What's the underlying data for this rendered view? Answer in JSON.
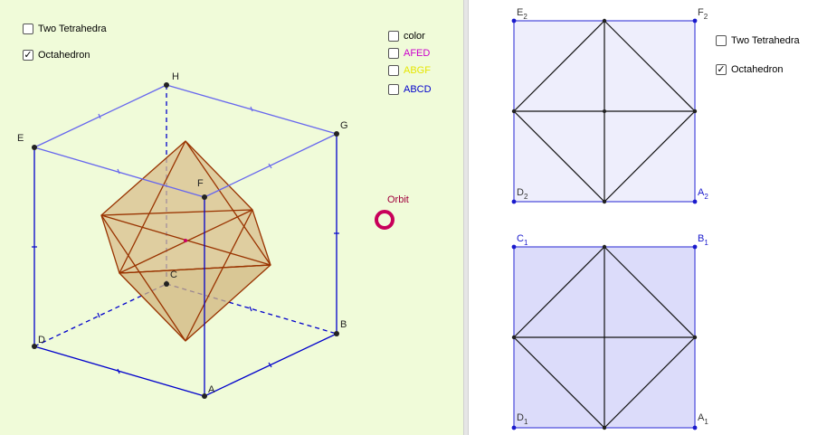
{
  "left_panel": {
    "checkboxes": [
      {
        "label": "Two Tetrahedra",
        "checked": false
      },
      {
        "label": "Octahedron",
        "checked": true
      }
    ],
    "face_checkboxes": [
      {
        "label": "color",
        "checked": false,
        "color": "#000000"
      },
      {
        "label": "AFED",
        "checked": false,
        "color": "#cc00cc"
      },
      {
        "label": "ABGF",
        "checked": false,
        "color": "#e6e600"
      },
      {
        "label": "ABCD",
        "checked": false,
        "color": "#0000cc"
      }
    ],
    "orbit_label": "Orbit",
    "cube_labels": [
      "A",
      "B",
      "C",
      "D",
      "E",
      "F",
      "G",
      "H"
    ]
  },
  "right_panel": {
    "checkboxes": [
      {
        "label": "Two Tetrahedra",
        "checked": false
      },
      {
        "label": "Octahedron",
        "checked": true
      }
    ],
    "top_square": {
      "corners": [
        {
          "letter": "E",
          "sub": "2"
        },
        {
          "letter": "F",
          "sub": "2"
        },
        {
          "letter": "D",
          "sub": "2"
        },
        {
          "letter": "A",
          "sub": "2"
        }
      ]
    },
    "bottom_square": {
      "corners": [
        {
          "letter": "C",
          "sub": "1"
        },
        {
          "letter": "B",
          "sub": "1"
        },
        {
          "letter": "D",
          "sub": "1"
        },
        {
          "letter": "A",
          "sub": "1"
        }
      ]
    }
  },
  "colors": {
    "left_bg": "#f0fbd9",
    "cube_edge_blue": "#0000cc",
    "cube_edge_light": "#6666ee",
    "octahedron_edge": "#993300",
    "octahedron_fill": "#d9bf8c",
    "orbit": "#c8005a",
    "square_top_fill": "#eeeefc",
    "square_bottom_fill": "#dcdcfa"
  }
}
